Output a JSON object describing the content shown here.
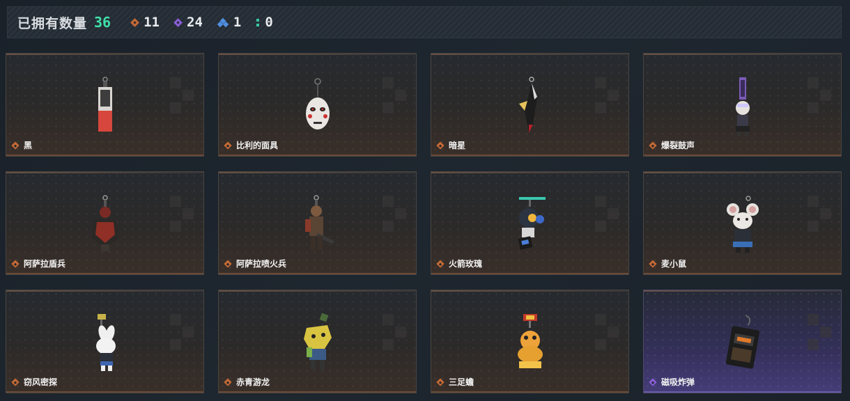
{
  "header": {
    "label": "已拥有数量",
    "total": "36",
    "stats": [
      {
        "icon": "orange-diamond-icon",
        "value": "11"
      },
      {
        "icon": "purple-diamond-icon",
        "value": "24"
      },
      {
        "icon": "blue-triangle-icon",
        "value": "1"
      },
      {
        "icon": "green-dots-icon",
        "value": "0"
      }
    ]
  },
  "colors": {
    "accent_green": "#3fe0a8",
    "rarity_orange": "#c56a35",
    "rarity_purple": "#8a5fd6",
    "rarity_blue": "#4f8fe0",
    "rarity_teal": "#38c7a2"
  },
  "items": [
    {
      "name": "黑",
      "rarity": "orange",
      "icon": "card-keychain-icon"
    },
    {
      "name": "比利的面具",
      "rarity": "orange",
      "icon": "billy-mask-icon"
    },
    {
      "name": "暗星",
      "rarity": "orange",
      "icon": "dark-star-keychain-icon"
    },
    {
      "name": "爆裂鼓声",
      "rarity": "orange",
      "icon": "drummer-figure-icon"
    },
    {
      "name": "阿萨拉盾兵",
      "rarity": "orange",
      "icon": "shield-soldier-figure-icon"
    },
    {
      "name": "阿萨拉喷火兵",
      "rarity": "orange",
      "icon": "flamethrower-soldier-figure-icon"
    },
    {
      "name": "火箭玫瑰",
      "rarity": "orange",
      "icon": "rocket-rose-figure-icon"
    },
    {
      "name": "麦小鼠",
      "rarity": "orange",
      "icon": "mouse-figure-icon"
    },
    {
      "name": "窃风密探",
      "rarity": "orange",
      "icon": "rabbit-spy-figure-icon"
    },
    {
      "name": "赤青游龙",
      "rarity": "orange",
      "icon": "dragon-figure-icon"
    },
    {
      "name": "三足蟾",
      "rarity": "orange",
      "icon": "three-legged-toad-figure-icon"
    },
    {
      "name": "磁吸炸弹",
      "rarity": "purple",
      "icon": "magnetic-bomb-icon"
    }
  ]
}
